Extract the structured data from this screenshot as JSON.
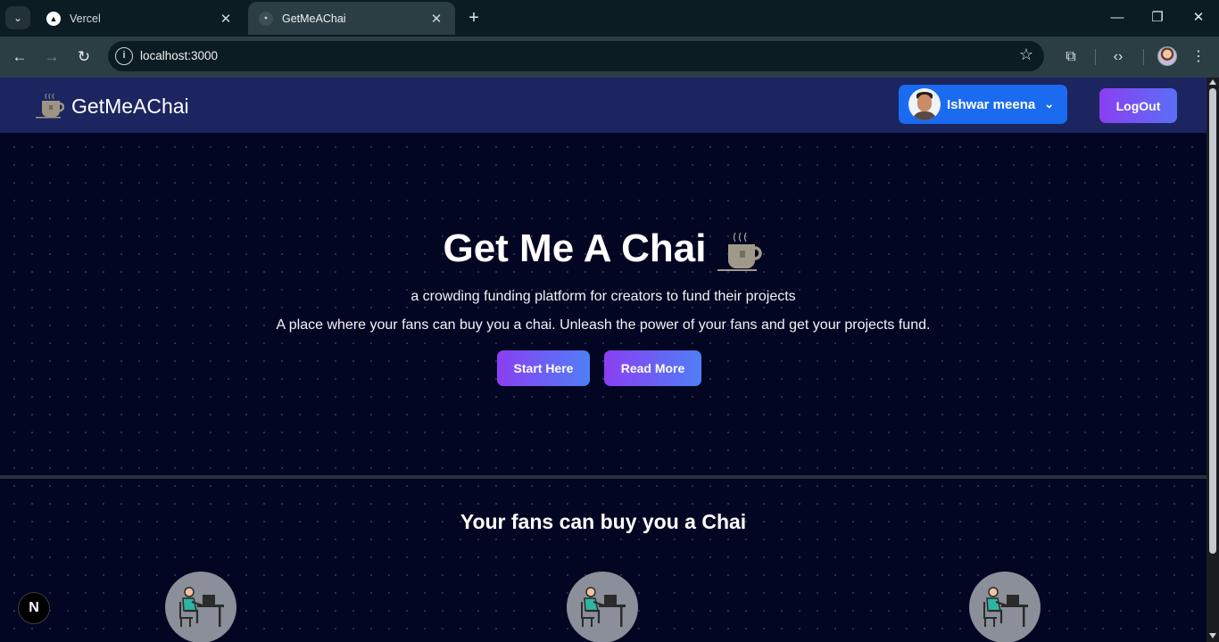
{
  "browser": {
    "tabs": [
      {
        "title": "Vercel",
        "icon": "vercel-triangle-icon"
      },
      {
        "title": "GetMeAChai",
        "icon": "site-favicon-icon"
      }
    ],
    "new_tab_symbol": "+",
    "address": "localhost:3000",
    "window_controls": {
      "minimize": "—",
      "maximize": "❐",
      "close": "✕"
    }
  },
  "site": {
    "brand": "GetMeAChai",
    "user": {
      "name": "Ishwar meena"
    },
    "logout_label": "LogOut"
  },
  "hero": {
    "title": "Get Me A Chai",
    "subtitle": "a crowding funding platform for creators to fund their projects",
    "description": "A place where your fans can buy you a chai. Unleash the power of your fans and get your projects fund.",
    "buttons": {
      "start": "Start Here",
      "read": "Read More"
    }
  },
  "section": {
    "title": "Your fans can buy you a Chai",
    "features": [
      {
        "icon": "person-at-desk-icon"
      },
      {
        "icon": "person-at-desk-icon"
      },
      {
        "icon": "person-at-desk-icon"
      }
    ]
  },
  "dev_badge": "N",
  "colors": {
    "navbar": "#1d2560",
    "page_bg": "#030622",
    "user_button": "#1a6bf0",
    "gradient_start": "#8a3ff2",
    "gradient_end": "#4f7ff6"
  }
}
